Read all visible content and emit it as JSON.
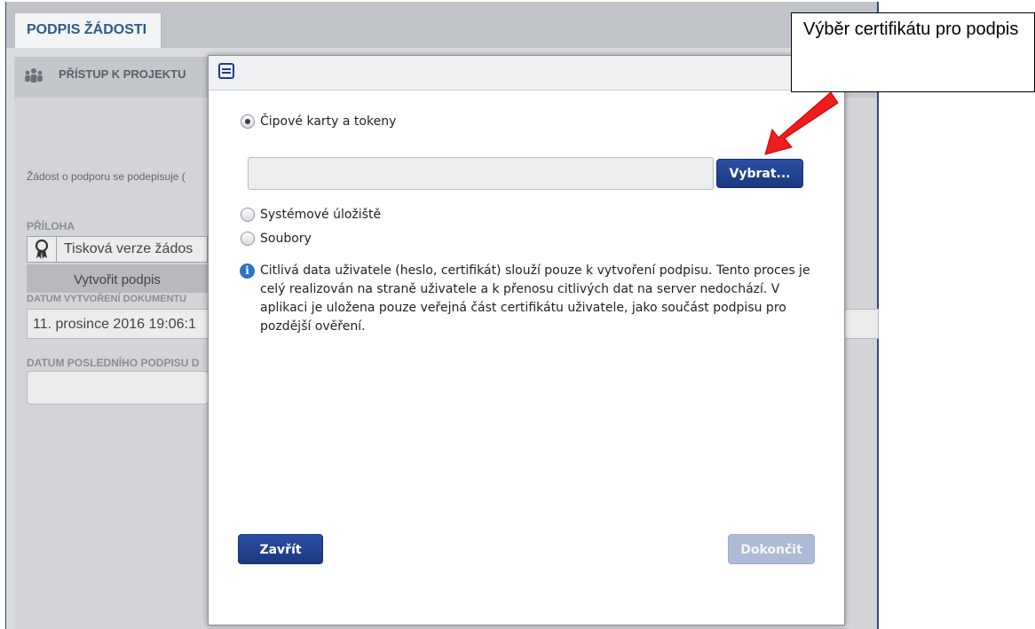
{
  "app": {
    "tab_title": "PODPIS ŽÁDOSTI",
    "subnav_label": "PŘÍSTUP K PROJEKTU",
    "description": "Žádost o podporu se podepisuje (",
    "attachment": {
      "section_label": "PŘÍLOHA",
      "file_name": "Tisková verze žádos",
      "create_signature_button": "Vytvořit podpis"
    },
    "created_date": {
      "label": "DATUM VYTVOŘENÍ DOKUMENTU",
      "value": "11. prosince 2016 19:06:1"
    },
    "last_signature_date": {
      "label": "DATUM POSLEDNÍHO PODPISU D",
      "value": ""
    }
  },
  "dialog": {
    "options": [
      {
        "label": "Čipové karty a tokeny",
        "selected": true
      },
      {
        "label": "Systémové úložiště",
        "selected": false
      },
      {
        "label": "Soubory",
        "selected": false
      }
    ],
    "certificate_input": {
      "value": "",
      "placeholder": ""
    },
    "select_button": "Vybrat...",
    "info_text": "Citlivá data uživatele (heslo, certifikát) slouží pouze k vytvoření podpisu. Tento proces je celý realizován na straně uživatele a k přenosu citlivých dat na server nedochází. V aplikaci je uložena pouze veřejná část certifikátu uživatele, jako součást podpisu pro pozdější ověření.",
    "close_button": "Zavřít",
    "finish_button": "Dokončit"
  },
  "annotation": {
    "callout_text": "Výběr certifikátu pro podpis",
    "arrow_color": "#ee1c1c"
  },
  "colors": {
    "primary_button": "#1f3d8a",
    "disabled_button": "#aebbd6",
    "title_blue": "#2f5a8a"
  },
  "icons": {
    "subnav": "people-group-icon",
    "attachment": "ribbon-icon",
    "dialog": "window-icon",
    "info": "info-icon"
  }
}
